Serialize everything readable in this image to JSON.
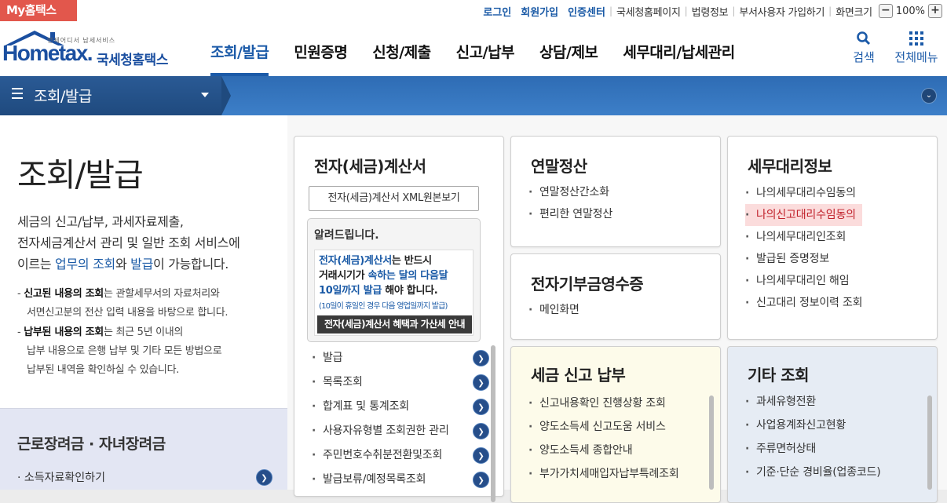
{
  "top": {
    "badge": "My홈택스",
    "links": {
      "login": "로그인",
      "signup": "회원가입",
      "cert": "인증센터",
      "nts_home": "국세청홈페이지",
      "law": "법령정보",
      "dept_signup": "부서사용자 가입하기",
      "screen_size": "화면크기"
    },
    "zoom": {
      "minus": "−",
      "value": "100%",
      "plus": "+"
    }
  },
  "header": {
    "logo_tag": "언제어디서 납세서비스",
    "logo_text": "Hometax.",
    "logo_kr": "국세청홈택스",
    "menu": [
      "조회/발급",
      "민원증명",
      "신청/제출",
      "신고/납부",
      "상담/제보",
      "세무대리/납세관리"
    ],
    "search_label": "검색",
    "all_menu_label": "전체메뉴"
  },
  "nav": {
    "title": "조회/발급"
  },
  "intro": {
    "title": "조회/발급",
    "desc1": "세금의 신고/납부, 과세자료제출,",
    "desc2": "전자세금계산서 관리 및 일반 조회 서비스에",
    "desc3_pre": "이르는 ",
    "desc3_b1": "업무의 조회",
    "desc3_mid": "와 ",
    "desc3_b2": "발급",
    "desc3_post": "이 가능합니다.",
    "note1_bold": "신고된 내용의 조회",
    "note1_rest": "는 관할세무서의 자료처리와",
    "note1_line2": "서면신고분의 전산 입력 내용을 바탕으로 합니다.",
    "note2_bold": "납부된 내용의 조회",
    "note2_rest": "는 최근 5년 이내의",
    "note2_line2": "납부 내용으로 은행 납부 및 기타 모든 방법으로",
    "note2_line3": "납부된 내역을 확인하실 수 있습니다."
  },
  "incentive": {
    "title": "근로장려금 · 자녀장려금",
    "item": "소득자료확인하기"
  },
  "einvoice": {
    "title": "전자(세금)계산서",
    "xml_button": "전자(세금)계산서 XML원본보기",
    "notice_title": "알려드립니다.",
    "notice_l1a": "전자(세금)계산서",
    "notice_l1b": "는 반드시",
    "notice_l2a": "거래시기가 ",
    "notice_l2b": "속하는 달의 다음달",
    "notice_l3a": "10일까지 발급",
    "notice_l3b": " 해야 합니다.",
    "notice_small": "(10일이 휴일인 경우 다음 영업일까지 발급)",
    "notice_bar": "전자(세금)계산서 혜택과 가산세 안내",
    "items": [
      "발급",
      "목록조회",
      "합계표 및 통계조회",
      "사용자유형별 조회권한 관리",
      "주민번호수취분전환및조회",
      "발급보류/예정목록조회"
    ]
  },
  "yearend": {
    "title": "연말정산",
    "items": [
      "연말정산간소화",
      "편리한 연말정산"
    ]
  },
  "donation": {
    "title": "전자기부금영수증",
    "items": [
      "메인화면"
    ]
  },
  "taxagent": {
    "title": "세무대리정보",
    "items": [
      "나의세무대리수임동의",
      "나의신고대리수임동의",
      "나의세무대리인조회",
      "발급된 증명정보",
      "나의세무대리인 해임",
      "신고대리 정보이력 조회"
    ]
  },
  "filing": {
    "title": "세금 신고 납부",
    "items": [
      "신고내용확인 진행상황 조회",
      "양도소득세 신고도움 서비스",
      "양도소득세 종합안내",
      "부가가치세매입자납부특례조회"
    ]
  },
  "etc": {
    "title": "기타 조회",
    "items": [
      "과세유형전환",
      "사업용계좌신고현황",
      "주류면허상태",
      "기준·단순 경비율(업종코드)"
    ]
  },
  "colors": {
    "brand": "#1b5aa8",
    "badge": "#e2574c",
    "highlight": "#fbdcdc",
    "filing_bg": "#fdfbea",
    "etc_bg": "#e6ecf4"
  }
}
